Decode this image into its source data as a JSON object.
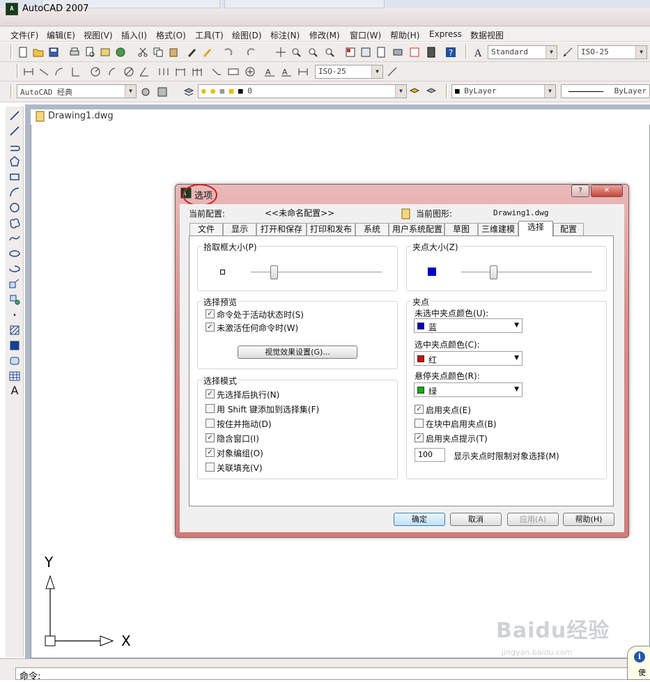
{
  "app": {
    "title": "AutoCAD 2007"
  },
  "menubar": [
    "文件(F)",
    "编辑(E)",
    "视图(V)",
    "插入(I)",
    "格式(O)",
    "工具(T)",
    "绘图(D)",
    "标注(N)",
    "修改(M)",
    "窗口(W)",
    "帮助(H)",
    "Express",
    "数据视图"
  ],
  "toolbar": {
    "text_style": "Standard",
    "dim_style": "ISO-25",
    "dim_style_2": "ISO-25",
    "workspace": "AutoCAD 经典",
    "layer": "0",
    "color": "ByLayer",
    "linetype": "ByLayer"
  },
  "document": {
    "title": "Drawing1.dwg"
  },
  "ucs": {
    "y_label": "Y",
    "x_label": "X"
  },
  "command": {
    "prompt": "命令:"
  },
  "watermark": {
    "text": "Baidu经验",
    "sub": "jingyan.baidu.com"
  },
  "info": {
    "text": "使"
  },
  "dialog": {
    "title": "选项",
    "help_glyph": "?",
    "close_glyph": "✕",
    "current_profile_label": "当前配置:",
    "current_profile_value": "<<未命名配置>>",
    "current_drawing_label": "当前图形:",
    "current_drawing_value": "Drawing1.dwg",
    "tabs": [
      "文件",
      "显示",
      "打开和保存",
      "打印和发布",
      "系统",
      "用户系统配置",
      "草图",
      "三维建模",
      "选择",
      "配置"
    ],
    "active_tab": "选择",
    "pickbox": {
      "title": "拾取框大小(P)",
      "level": 0.15
    },
    "gripsize": {
      "title": "夹点大小(Z)",
      "level": 0.22
    },
    "preview": {
      "title": "选择预览",
      "options": [
        {
          "label": "命令处于活动状态时(S)",
          "checked": true
        },
        {
          "label": "未激活任何命令时(W)",
          "checked": true
        }
      ],
      "visual_button": "视觉效果设置(G)..."
    },
    "modes": {
      "title": "选择模式",
      "options": [
        {
          "label": "先选择后执行(N)",
          "checked": true
        },
        {
          "label": "用 Shift 键添加到选择集(F)",
          "checked": false
        },
        {
          "label": "按住并拖动(D)",
          "checked": false
        },
        {
          "label": "隐含窗口(I)",
          "checked": true
        },
        {
          "label": "对象编组(O)",
          "checked": true
        },
        {
          "label": "关联填充(V)",
          "checked": false
        }
      ]
    },
    "grips": {
      "title": "夹点",
      "unselected_label": "未选中夹点颜色(U):",
      "unselected_value": "蓝",
      "unselected_color": "#0000cc",
      "selected_label": "选中夹点颜色(C):",
      "selected_value": "红",
      "selected_color": "#d01010",
      "hover_label": "悬停夹点颜色(R):",
      "hover_value": "绿",
      "hover_color": "#10b010",
      "options": [
        {
          "label": "启用夹点(E)",
          "checked": true
        },
        {
          "label": "在块中启用夹点(B)",
          "checked": false
        },
        {
          "label": "启用夹点提示(T)",
          "checked": true
        }
      ],
      "limit_value": "100",
      "limit_label": "显示夹点时限制对象选择(M)"
    },
    "buttons": {
      "ok": "确定",
      "cancel": "取消",
      "apply": "应用(A)",
      "help": "帮助(H)"
    }
  }
}
